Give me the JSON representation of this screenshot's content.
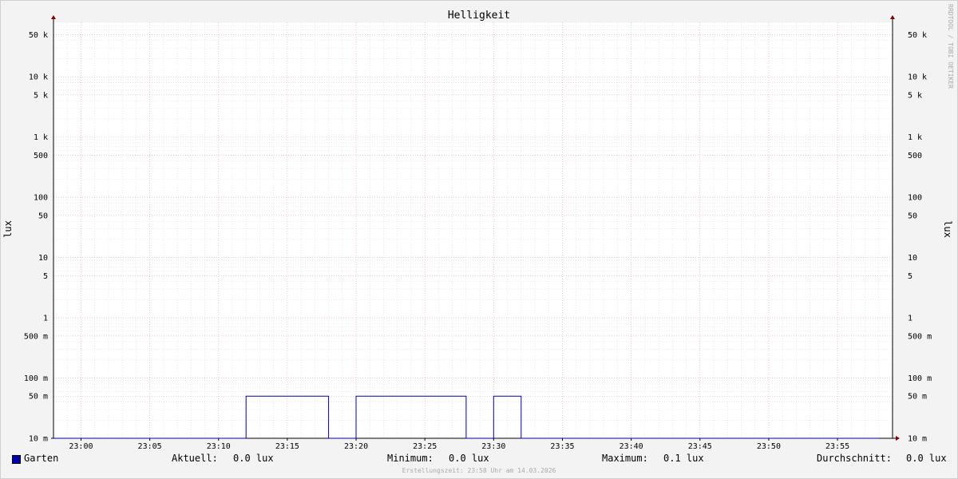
{
  "chart_data": {
    "type": "line",
    "title": "Helligkeit",
    "ylabel": "lux",
    "yscale": "log",
    "ylim": [
      0.01,
      80000
    ],
    "xlim": [
      "22:58",
      "23:59"
    ],
    "x_ticks": [
      "23:00",
      "23:05",
      "23:10",
      "23:15",
      "23:20",
      "23:25",
      "23:30",
      "23:35",
      "23:40",
      "23:45",
      "23:50",
      "23:55"
    ],
    "y_ticks": [
      {
        "value": 0.01,
        "label": "10 m"
      },
      {
        "value": 0.05,
        "label": "50 m"
      },
      {
        "value": 0.1,
        "label": "100 m"
      },
      {
        "value": 0.5,
        "label": "500 m"
      },
      {
        "value": 1,
        "label": "1"
      },
      {
        "value": 5,
        "label": "5"
      },
      {
        "value": 10,
        "label": "10"
      },
      {
        "value": 50,
        "label": "50"
      },
      {
        "value": 100,
        "label": "100"
      },
      {
        "value": 500,
        "label": "500"
      },
      {
        "value": 1000,
        "label": "1 k"
      },
      {
        "value": 5000,
        "label": "5 k"
      },
      {
        "value": 10000,
        "label": "10 k"
      },
      {
        "value": 50000,
        "label": "50 k"
      }
    ],
    "grid": true,
    "series": [
      {
        "name": "Garten",
        "color": "#0000aa",
        "points": [
          [
            "22:58",
            0.0
          ],
          [
            "23:12",
            0.0
          ],
          [
            "23:12",
            0.05
          ],
          [
            "23:18",
            0.05
          ],
          [
            "23:18",
            0.0
          ],
          [
            "23:20",
            0.0
          ],
          [
            "23:20",
            0.05
          ],
          [
            "23:28",
            0.05
          ],
          [
            "23:28",
            0.0
          ],
          [
            "23:30",
            0.0
          ],
          [
            "23:30",
            0.05
          ],
          [
            "23:32",
            0.05
          ],
          [
            "23:32",
            0.0
          ],
          [
            "23:58",
            0.0
          ]
        ]
      }
    ]
  },
  "legend": {
    "series_name": "Garten",
    "current_label": "Aktuell:",
    "current_value": "0.0 lux",
    "min_label": "Minimum:",
    "min_value": "0.0 lux",
    "max_label": "Maximum:",
    "max_value": "0.1 lux",
    "avg_label": "Durchschnitt:",
    "avg_value": "0.0 lux"
  },
  "footer": "Erstellungszeit: 23:58 Uhr am 14.03.2026",
  "watermark": "RRDTOOL / TOBI OETIKER",
  "colors": {
    "background": "#f3f3f3",
    "canvas": "#ffffff",
    "grid_minor": "#dddddd",
    "grid_major": "#f0a0a0",
    "axis": "#000000",
    "arrow": "#800000",
    "series": "#0000aa"
  }
}
